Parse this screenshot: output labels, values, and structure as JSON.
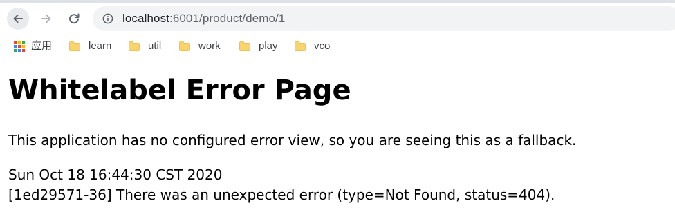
{
  "browser": {
    "url_host": "localhost",
    "url_path": ":6001/product/demo/1",
    "icons": {
      "back": "back-arrow-icon",
      "forward": "forward-arrow-icon",
      "reload": "reload-icon",
      "site_info": "info-icon"
    },
    "bookmarks": [
      {
        "label": "应用",
        "icon": "apps-grid-icon"
      },
      {
        "label": "learn",
        "icon": "folder-icon"
      },
      {
        "label": "util",
        "icon": "folder-icon"
      },
      {
        "label": "work",
        "icon": "folder-icon"
      },
      {
        "label": "play",
        "icon": "folder-icon"
      },
      {
        "label": "vco",
        "icon": "folder-icon"
      }
    ],
    "colors": {
      "folder": "#f8d46a",
      "omnibox_bg": "#f1f3f4"
    }
  },
  "page": {
    "title": "Whitelabel Error Page",
    "description": "This application has no configured error view, so you are seeing this as a fallback.",
    "timestamp": "Sun Oct 18 16:44:30 CST 2020",
    "error_detail": "[1ed29571-36] There was an unexpected error (type=Not Found, status=404)."
  }
}
